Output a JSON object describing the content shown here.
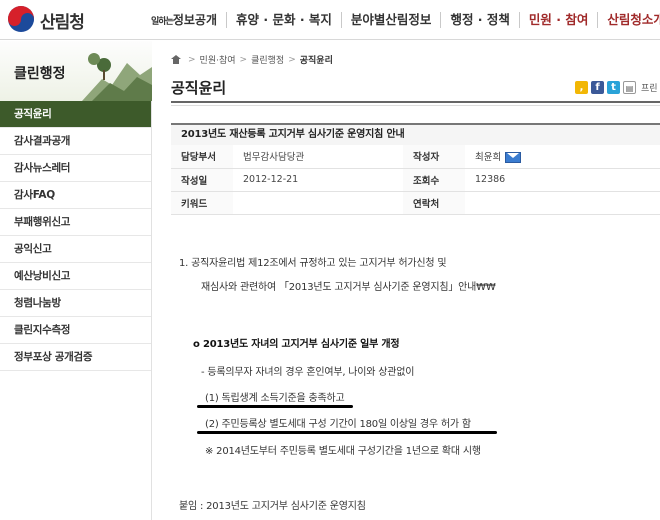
{
  "header": {
    "logo_text": "산림청",
    "nav": [
      {
        "prefix": "일하는",
        "label": "정보공개"
      },
      {
        "label": "휴양 · 문화 · 복지"
      },
      {
        "label": "분야별산림정보"
      },
      {
        "label": "행정 · 정책"
      },
      {
        "label": "민원 · 참여"
      },
      {
        "label": "산림청소개"
      }
    ]
  },
  "sidebar": {
    "title": "클린행정",
    "items": [
      "공직윤리",
      "감사결과공개",
      "감사뉴스레터",
      "감사FAQ",
      "부패행위신고",
      "공익신고",
      "예산낭비신고",
      "청렴나눔방",
      "클린지수측정",
      "정부포상 공개검증"
    ]
  },
  "breadcrumb": [
    "민원·참여",
    "클린행정",
    "공직윤리"
  ],
  "page_title": "공직윤리",
  "share": {
    "print_label": "프린"
  },
  "article": {
    "title": "2013년도 재산등록 고지거부 심사기준 운영지침 안내",
    "labels": {
      "dept": "담당부서",
      "author": "작성자",
      "date": "작성일",
      "views": "조회수",
      "keyword": "키워드",
      "contact": "연락처"
    },
    "dept": "법무감사담당관",
    "author": "최윤희",
    "date": "2012-12-21",
    "views": "12386",
    "keyword": "",
    "contact": ""
  },
  "body": {
    "p1": "1. 공직자윤리법 제12조에서 규정하고 있는 고지거부 허가신청 및",
    "p1b": "재심사와 관련하여 「2013년도 고지거부 심사기준 운영지침」안내₩₩",
    "section": "o  2013년도 자녀의 고지거부 심사기준 일부 개정",
    "bullet": "- 등록의무자 자녀의 경우 혼인여부, 나이와 상관없이",
    "item1": "(1) 독립생계 소득기준을 충족하고",
    "item2": "(2) 주민등록상 별도세대 구성 기간이 180일 이상일 경우 허가 함",
    "note": "※ 2014년도부터 주민등록 별도세대 구성기간을 1년으로 확대 시행",
    "attach": "붙임  :  2013년도 고지거부 심사기준 운영지침"
  },
  "colors": {
    "active_menu": "#3d5a2a",
    "active_nav": "#a02a2a",
    "share_kakao": "#f2b705",
    "share_facebook": "#3b5998",
    "share_twitter": "#2aa3d8"
  }
}
